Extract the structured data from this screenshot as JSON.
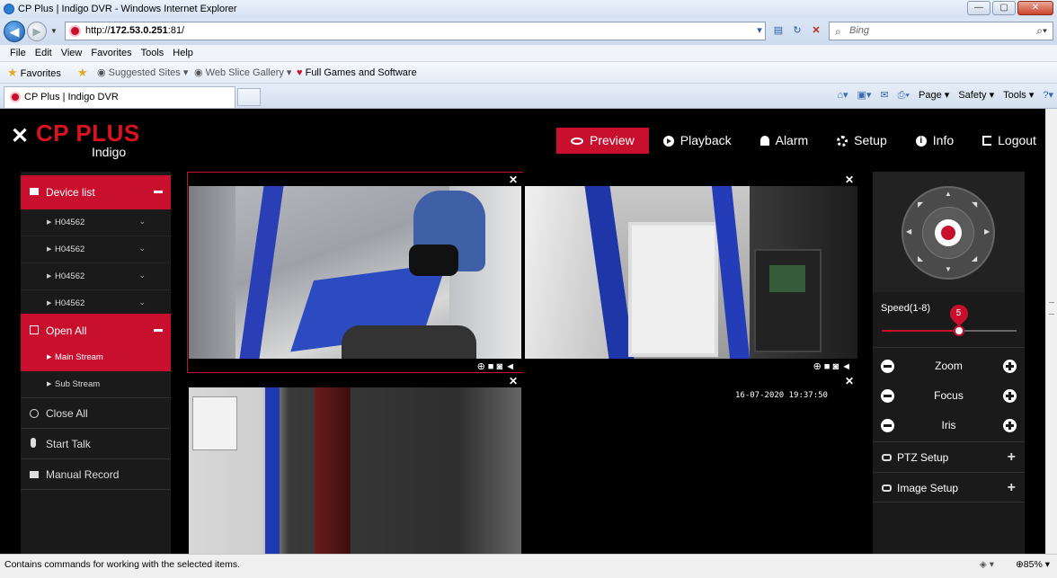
{
  "window": {
    "title": "CP Plus | Indigo DVR - Windows Internet Explorer",
    "buttons": {
      "minimize": "—",
      "maximize": "▢",
      "close": "✕"
    }
  },
  "browser": {
    "url_prefix": "http://",
    "url_host": "172.53.0.251",
    "url_suffix": ":81/",
    "search_placeholder": "Bing",
    "menu": [
      "File",
      "Edit",
      "View",
      "Favorites",
      "Tools",
      "Help"
    ],
    "favorites_label": "Favorites",
    "fav_links": [
      "Suggested Sites ▾",
      "Web Slice Gallery ▾",
      "Full Games and Software"
    ],
    "tab_title": "CP Plus | Indigo DVR",
    "commands": [
      "Page ▾",
      "Safety ▾",
      "Tools ▾"
    ]
  },
  "app": {
    "brand": "CP PLUS",
    "brand_sub": "Indigo",
    "nav": [
      "Preview",
      "Playback",
      "Alarm",
      "Setup",
      "Info",
      "Logout"
    ],
    "sidebar": {
      "device_list": "Device list",
      "devices": [
        "H04562",
        "H04562",
        "H04562",
        "H04562"
      ],
      "open_all": "Open All",
      "main_stream": "Main Stream",
      "sub_stream": "Sub Stream",
      "close_all": "Close All",
      "start_talk": "Start Talk",
      "manual_record": "Manual Record"
    },
    "video": {
      "close_glyph": "✕",
      "controls_glyphs": "⊕■◙◄",
      "timestamp_ch4": "16-07-2020 19:37:50"
    },
    "ptz": {
      "speed_label": "Speed(1-8)",
      "speed_value": "5",
      "speed_fraction": 0.57,
      "zoom": "Zoom",
      "focus": "Focus",
      "iris": "Iris",
      "ptz_setup": "PTZ Setup",
      "image_setup": "Image Setup"
    }
  },
  "status": {
    "message": "Contains commands for working with the selected items.",
    "zoom": "85%"
  }
}
